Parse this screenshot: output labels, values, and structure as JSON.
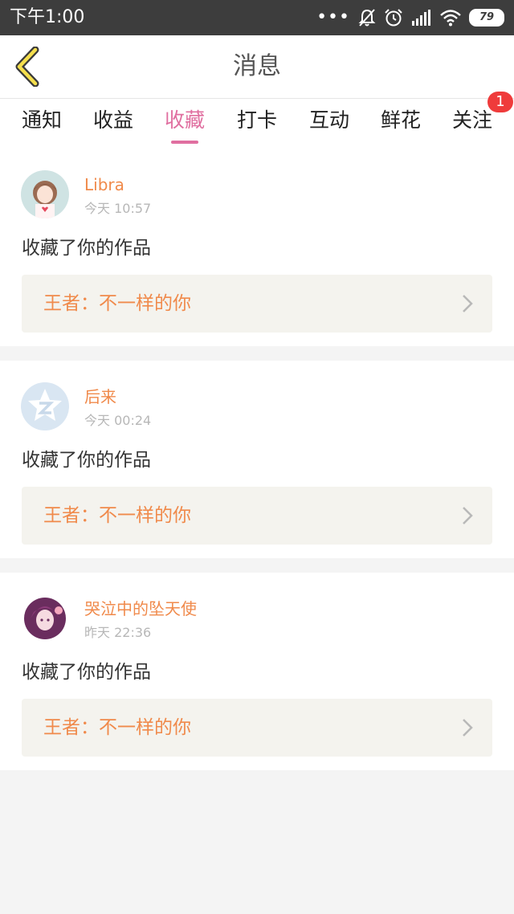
{
  "status_bar": {
    "time": "下午1:00",
    "dots": "•••",
    "battery": "79",
    "icons": [
      "mute-bell-icon",
      "alarm-icon",
      "signal-icon",
      "wifi-icon",
      "battery-icon"
    ]
  },
  "nav": {
    "title": "消息",
    "back_icon": "chevron-left-icon"
  },
  "tabs": {
    "items": [
      {
        "label": "通知"
      },
      {
        "label": "收益"
      },
      {
        "label": "收藏"
      },
      {
        "label": "打卡"
      },
      {
        "label": "互动"
      },
      {
        "label": "鲜花"
      },
      {
        "label": "关注"
      }
    ],
    "active": "收藏",
    "badge": "1"
  },
  "messages": [
    {
      "username": "Libra",
      "time": "今天 10:57",
      "action": "收藏了你的作品",
      "work_title": "王者：不一样的你"
    },
    {
      "username": "后来",
      "time": "今天 00:24",
      "action": "收藏了你的作品",
      "work_title": "王者：不一样的你"
    },
    {
      "username": "哭泣中的坠天使",
      "time": "昨天 22:36",
      "action": "收藏了你的作品",
      "work_title": "王者：不一样的你"
    }
  ],
  "colors": {
    "accent_pink": "#e06fa0",
    "username_orange": "#f08a4b",
    "badge_red": "#ef3b3b",
    "status_bar": "#3d3d3d"
  }
}
